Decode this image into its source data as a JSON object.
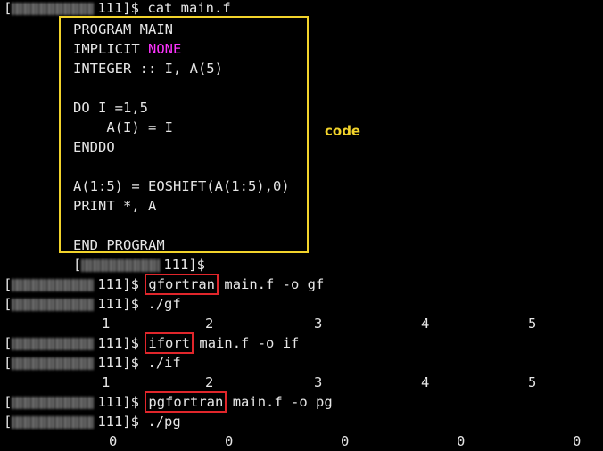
{
  "terminal": {
    "line1": {
      "host": "111]$",
      "cmd": "cat main.f"
    },
    "code": [
      "PROGRAM MAIN",
      "IMPLICIT ",
      "INTEGER :: I, A(5)",
      "",
      "DO I =1,5",
      "    A(I) = I",
      "ENDDO",
      "",
      "A(1:5) = EOSHIFT(A(1:5),0)",
      "PRINT *, A",
      "",
      "END PROGRAM"
    ],
    "code_keyword": "NONE",
    "code_label": "code",
    "line_after_code": {
      "host": "111]$"
    },
    "gf_compile": {
      "host": "111]$",
      "compiler": "gfortran",
      "args": "main.f -o gf"
    },
    "gf_run": {
      "host": "111]$",
      "cmd": "./gf"
    },
    "gf_output": [
      "1",
      "2",
      "3",
      "4",
      "5"
    ],
    "if_compile": {
      "host": "111]$",
      "compiler": "ifort",
      "args": "main.f -o if"
    },
    "if_run": {
      "host": "111]$",
      "cmd": "./if"
    },
    "if_output": [
      "1",
      "2",
      "3",
      "4",
      "5"
    ],
    "pg_compile": {
      "host": "111]$",
      "compiler": "pgfortran",
      "args": "main.f -o pg"
    },
    "pg_run": {
      "host": "111]$",
      "cmd": "./pg"
    },
    "pg_output": [
      "0",
      "0",
      "0",
      "0",
      "0"
    ]
  },
  "colors": {
    "highlight_box": "#e0262b",
    "code_box": "#f2d32b",
    "keyword": "#ff33ff"
  }
}
